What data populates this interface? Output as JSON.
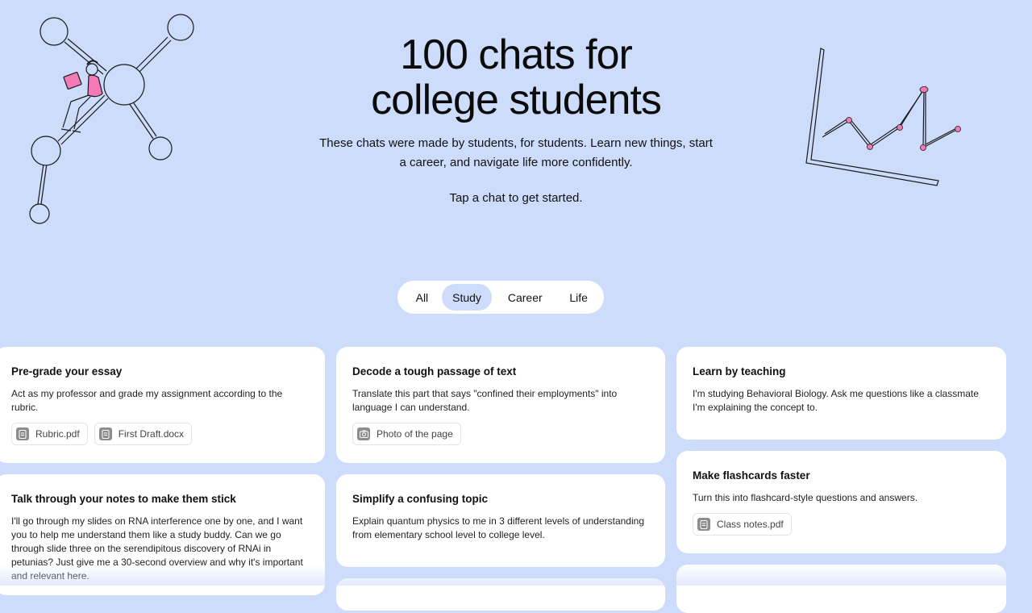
{
  "hero": {
    "title_line1": "100 chats for",
    "title_line2": "college students",
    "subtitle": "These chats were made by students, for students. Learn new things, start a career, and navigate life more confidently.",
    "cta": "Tap a chat to get started."
  },
  "filters": {
    "tabs": [
      "All",
      "Study",
      "Career",
      "Life"
    ],
    "active": "Study"
  },
  "colors": {
    "background": "#cddcfb",
    "card": "#ffffff",
    "accent_pink": "#f27ab6"
  },
  "cards": [
    {
      "title": "Pre-grade your essay",
      "description": "Act as my professor and grade my assignment according to the rubric.",
      "attachments": [
        {
          "icon": "document-icon",
          "label": "Rubric.pdf"
        },
        {
          "icon": "document-icon",
          "label": "First Draft.docx"
        }
      ]
    },
    {
      "title": "Decode a tough passage of text",
      "description": "Translate this part that says \"confined their employments\" into language I can understand.",
      "attachments": [
        {
          "icon": "camera-icon",
          "label": "Photo of the page"
        }
      ]
    },
    {
      "title": "Learn by teaching",
      "description": "I'm studying Behavioral Biology. Ask me questions like a classmate I'm explaining the concept to.",
      "attachments": []
    },
    {
      "title": "Talk through your notes to make them stick",
      "description": "I'll go through my slides on RNA interference one by one, and I want you to help me understand them like a study buddy. Can we go through slide three on the serendipitous discovery of RNAi in petunias? Just give me a 30-second overview and why it's important and relevant here.",
      "attachments": []
    },
    {
      "title": "Simplify a confusing topic",
      "description": "Explain quantum physics to me in 3 different levels of understanding from elementary school level to college level.",
      "attachments": []
    },
    {
      "title": "Make flashcards faster",
      "description": "Turn this into flashcard-style questions and answers.",
      "attachments": [
        {
          "icon": "document-icon",
          "label": "Class notes.pdf"
        }
      ]
    }
  ]
}
